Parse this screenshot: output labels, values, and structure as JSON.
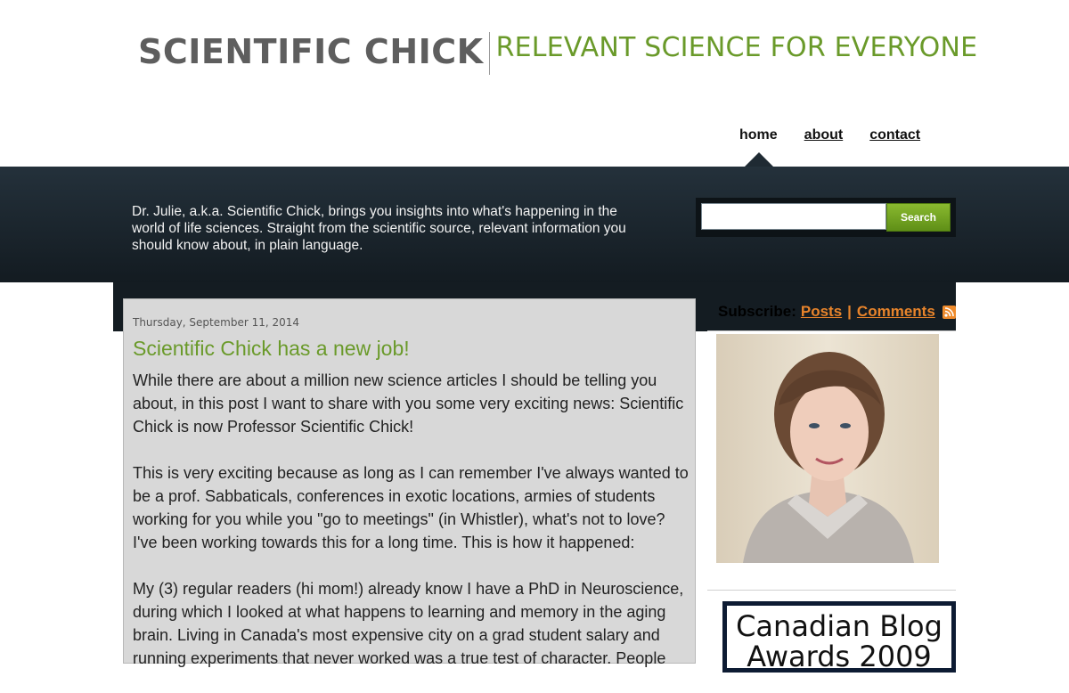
{
  "header": {
    "site_name": "SCIENTIFIC CHICK",
    "tagline": "RELEVANT SCIENCE FOR EVERYONE"
  },
  "nav": {
    "items": [
      {
        "label": "home",
        "active": true
      },
      {
        "label": "about",
        "active": false
      },
      {
        "label": "contact",
        "active": false
      }
    ]
  },
  "intro": {
    "text": "Dr. Julie, a.k.a. Scientific Chick, brings you insights into what's happening in the world of life sciences. Straight from the scientific source, relevant information you should know about, in plain language."
  },
  "search": {
    "value": "",
    "button_label": "Search"
  },
  "post": {
    "date": "Thursday, September 11, 2014",
    "title": "Scientific Chick has a new job!",
    "paragraphs": [
      "While there are about a million new science articles I should be telling you about, in this post I want to share with you some very exciting news: Scientific Chick is now Professor Scientific Chick!",
      "This is very exciting because as long as I can remember I've always wanted to be a prof. Sabbaticals, conferences in exotic locations, armies of students working for you while you \"go to meetings\" (in Whistler), what's not to love? I've been working towards this for a long time. This is how it happened:",
      "My (3) regular readers (hi mom!) already know I have a PhD in Neuroscience, during which I looked at what happens to learning and memory in the aging brain. Living in Canada's most expensive city on a grad student salary and running experiments that never worked was a true test of character. People"
    ]
  },
  "sidebar": {
    "subscribe_label": "Subscribe:",
    "posts_link": "Posts",
    "separator": "|",
    "comments_link": "Comments",
    "award_text": "Canadian Blog Awards 2009"
  },
  "colors": {
    "accent_green": "#6a9a2a",
    "link_orange": "#e8842b",
    "dark_band": "#1f2a33",
    "post_bg": "#d8d8d8"
  }
}
